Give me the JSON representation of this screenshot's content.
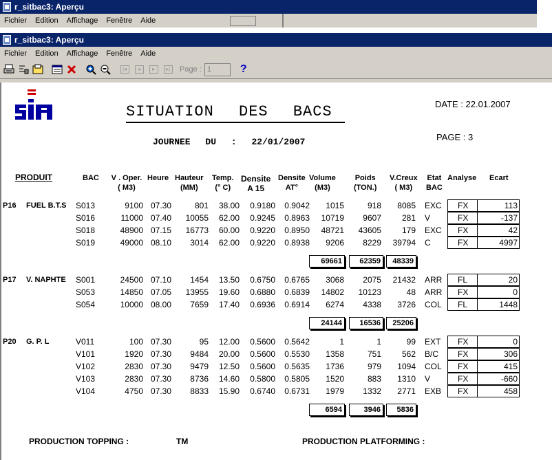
{
  "back_window": {
    "title": "r_sitbac3: Aperçu",
    "menu": [
      "Fichier",
      "Edition",
      "Affichage",
      "Fenêtre",
      "Aide"
    ]
  },
  "window": {
    "title": "r_sitbac3: Aperçu",
    "menu": [
      "Fichier",
      "Edition",
      "Affichage",
      "Fenêtre",
      "Aide"
    ],
    "toolbar": {
      "page_label": "Page :",
      "page_value": "1",
      "help": "?"
    }
  },
  "report": {
    "title": "SITUATION   DES   BACS",
    "journee_label": "JOURNEE",
    "du_label": "DU",
    "colon": ":",
    "journee_date": "22/01/2007",
    "date_label": "DATE :  22.01.2007",
    "page_label": "PAGE :  3",
    "headers": {
      "produit": "PRODUIT",
      "bac": "BAC",
      "voper": "V . Oper.\n( M3)",
      "heure": "Heure",
      "hauteur": "Hauteur\n(MM)",
      "temp": "Temp.\n(° C)",
      "densite15": "Densite\nA 15",
      "densiteat": "Densite\nAT°",
      "volume": "Volume\n(M3)",
      "poids": "Poids\n(TON.)",
      "vcreux": "V.Creux\n( M3)",
      "etat": "Etat\nBAC",
      "analyse": "Analyse",
      "ecart": "Ecart"
    },
    "groups": [
      {
        "code": "P16",
        "name": "FUEL B.T.S",
        "rows": [
          {
            "bac": "S013",
            "voper": "9100",
            "heure": "07.30",
            "hauteur": "801",
            "temp": "38.00",
            "d15": "0.9180",
            "dat": "0.9042",
            "volume": "1015",
            "poids": "918",
            "vcreux": "8085",
            "etat": "EXC",
            "analyse": "FX",
            "ecart": "113"
          },
          {
            "bac": "S016",
            "voper": "11000",
            "heure": "07.40",
            "hauteur": "10055",
            "temp": "62.00",
            "d15": "0.9245",
            "dat": "0.8963",
            "volume": "10719",
            "poids": "9607",
            "vcreux": "281",
            "etat": "V",
            "analyse": "FX",
            "ecart": "-137"
          },
          {
            "bac": "S018",
            "voper": "48900",
            "heure": "07.15",
            "hauteur": "16773",
            "temp": "60.00",
            "d15": "0.9220",
            "dat": "0.8950",
            "volume": "48721",
            "poids": "43605",
            "vcreux": "179",
            "etat": "EXC",
            "analyse": "FX",
            "ecart": "42"
          },
          {
            "bac": "S019",
            "voper": "49000",
            "heure": "08.10",
            "hauteur": "3014",
            "temp": "62.00",
            "d15": "0.9220",
            "dat": "0.8938",
            "volume": "9206",
            "poids": "8229",
            "vcreux": "39794",
            "etat": "C",
            "analyse": "FX",
            "ecart": "4997"
          }
        ],
        "totals": {
          "volume": "69661",
          "poids": "62359",
          "vcreux": "48339"
        }
      },
      {
        "code": "P17",
        "name": "V. NAPHTE",
        "rows": [
          {
            "bac": "S001",
            "voper": "24500",
            "heure": "07.10",
            "hauteur": "1454",
            "temp": "13.50",
            "d15": "0.6750",
            "dat": "0.6765",
            "volume": "3068",
            "poids": "2075",
            "vcreux": "21432",
            "etat": "ARR",
            "analyse": "FL",
            "ecart": "20"
          },
          {
            "bac": "S053",
            "voper": "14850",
            "heure": "07.05",
            "hauteur": "13955",
            "temp": "19.60",
            "d15": "0.6880",
            "dat": "0.6839",
            "volume": "14802",
            "poids": "10123",
            "vcreux": "48",
            "etat": "ARR",
            "analyse": "FX",
            "ecart": "0"
          },
          {
            "bac": "S054",
            "voper": "10000",
            "heure": "08.00",
            "hauteur": "7659",
            "temp": "17.40",
            "d15": "0.6936",
            "dat": "0.6914",
            "volume": "6274",
            "poids": "4338",
            "vcreux": "3726",
            "etat": "COL",
            "analyse": "FL",
            "ecart": "1448"
          }
        ],
        "totals": {
          "volume": "24144",
          "poids": "16536",
          "vcreux": "25206"
        }
      },
      {
        "code": "P20",
        "name": "G. P. L",
        "rows": [
          {
            "bac": "V011",
            "voper": "100",
            "heure": "07.30",
            "hauteur": "95",
            "temp": "12.00",
            "d15": "0.5600",
            "dat": "0.5642",
            "volume": "1",
            "poids": "1",
            "vcreux": "99",
            "etat": "EXT",
            "analyse": "FX",
            "ecart": "0"
          },
          {
            "bac": "V101",
            "voper": "1920",
            "heure": "07.30",
            "hauteur": "9484",
            "temp": "20.00",
            "d15": "0.5600",
            "dat": "0.5530",
            "volume": "1358",
            "poids": "751",
            "vcreux": "562",
            "etat": "B/C",
            "analyse": "FX",
            "ecart": "306"
          },
          {
            "bac": "V102",
            "voper": "2830",
            "heure": "07.30",
            "hauteur": "9479",
            "temp": "12.50",
            "d15": "0.5600",
            "dat": "0.5635",
            "volume": "1736",
            "poids": "979",
            "vcreux": "1094",
            "etat": "COL",
            "analyse": "FX",
            "ecart": "415"
          },
          {
            "bac": "V103",
            "voper": "2830",
            "heure": "07.30",
            "hauteur": "8736",
            "temp": "14.60",
            "d15": "0.5800",
            "dat": "0.5805",
            "volume": "1520",
            "poids": "883",
            "vcreux": "1310",
            "etat": "V",
            "analyse": "FX",
            "ecart": "-660"
          },
          {
            "bac": "V104",
            "voper": "4750",
            "heure": "07.30",
            "hauteur": "8833",
            "temp": "15.90",
            "d15": "0.6740",
            "dat": "0.6731",
            "volume": "1979",
            "poids": "1332",
            "vcreux": "2771",
            "etat": "EXB",
            "analyse": "FX",
            "ecart": "458"
          }
        ],
        "totals": {
          "volume": "6594",
          "poids": "3946",
          "vcreux": "5836"
        }
      }
    ],
    "footer": {
      "production_topping": "PRODUCTION TOPPING  :",
      "tm": "TM",
      "production_platforming": "PRODUCTION PLATFORMING :"
    }
  }
}
